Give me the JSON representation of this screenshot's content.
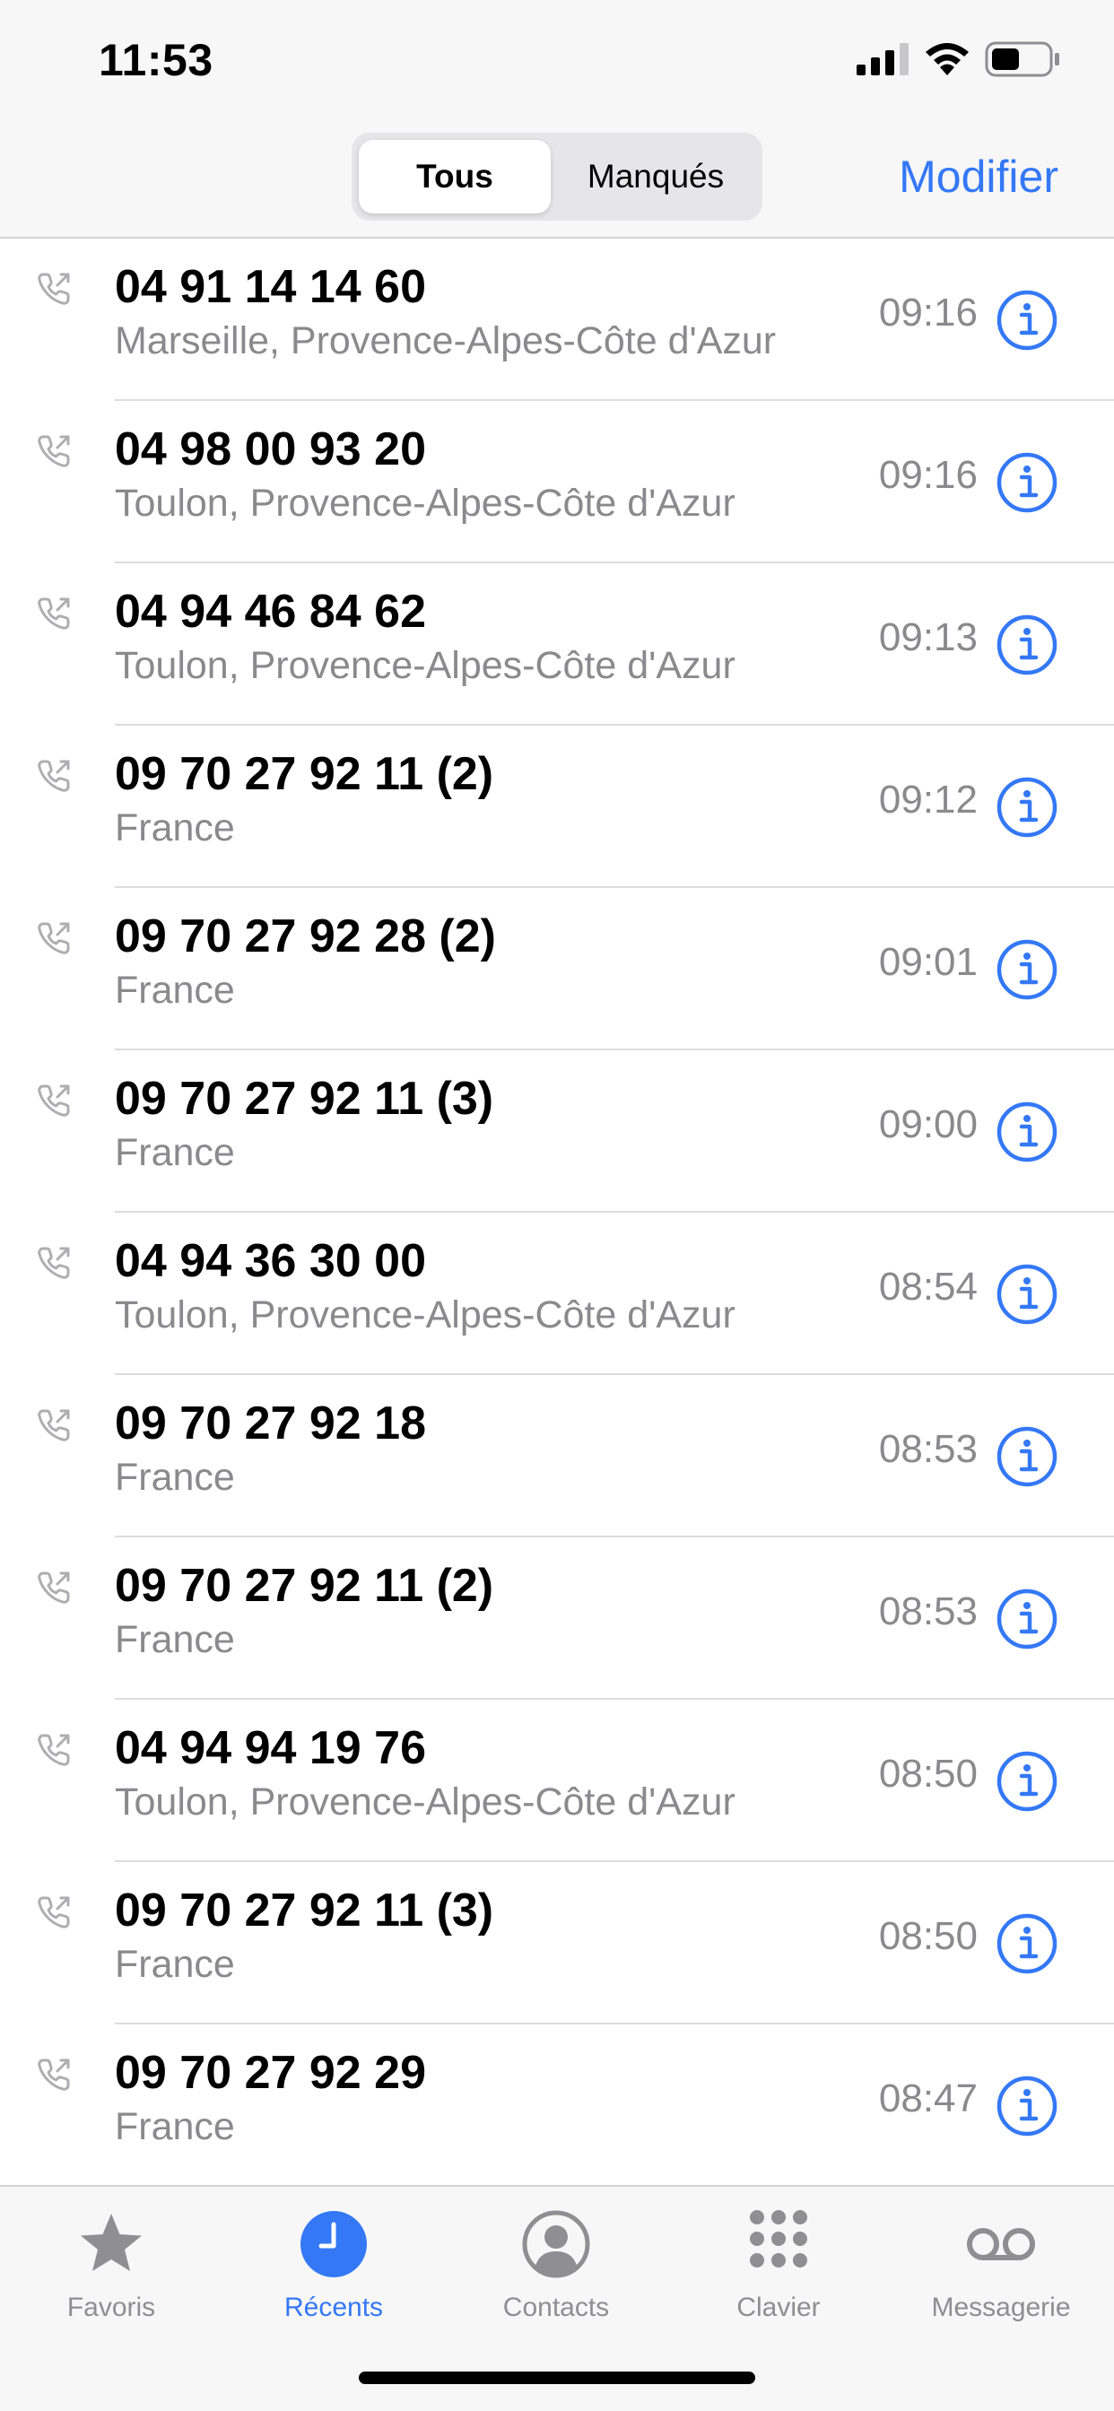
{
  "status_bar": {
    "time": "11:53",
    "icons": [
      "cellular-signal-icon",
      "wifi-icon",
      "battery-icon"
    ]
  },
  "nav": {
    "segments": [
      "Tous",
      "Manqués"
    ],
    "selected_segment": "Tous",
    "edit_label": "Modifier"
  },
  "colors": {
    "accent": "#3478f6",
    "secondary_text": "#8a8a8e",
    "separator": "#dcdcde"
  },
  "calls": [
    {
      "number": "04 91 14 14 60",
      "location": "Marseille, Provence-Alpes-Côte d'Azur",
      "time": "09:16"
    },
    {
      "number": "04 98 00 93 20",
      "location": "Toulon, Provence-Alpes-Côte d'Azur",
      "time": "09:16"
    },
    {
      "number": "04 94 46 84 62",
      "location": "Toulon, Provence-Alpes-Côte d'Azur",
      "time": "09:13"
    },
    {
      "number": "09 70 27 92 11 (2)",
      "location": "France",
      "time": "09:12"
    },
    {
      "number": "09 70 27 92 28 (2)",
      "location": "France",
      "time": "09:01"
    },
    {
      "number": "09 70 27 92 11 (3)",
      "location": "France",
      "time": "09:00"
    },
    {
      "number": "04 94 36 30 00",
      "location": "Toulon, Provence-Alpes-Côte d'Azur",
      "time": "08:54"
    },
    {
      "number": "09 70 27 92 18",
      "location": "France",
      "time": "08:53"
    },
    {
      "number": "09 70 27 92 11 (2)",
      "location": "France",
      "time": "08:53"
    },
    {
      "number": "04 94 94 19 76",
      "location": "Toulon, Provence-Alpes-Côte d'Azur",
      "time": "08:50"
    },
    {
      "number": "09 70 27 92 11 (3)",
      "location": "France",
      "time": "08:50"
    },
    {
      "number": "09 70 27 92 29",
      "location": "France",
      "time": "08:47"
    }
  ],
  "call_icons": {
    "call_type": "outgoing-call-icon",
    "info": "info-icon"
  },
  "tabs": [
    {
      "label": "Favoris",
      "icon": "star-icon",
      "active": false
    },
    {
      "label": "Récents",
      "icon": "clock-icon",
      "active": true
    },
    {
      "label": "Contacts",
      "icon": "person-circle-icon",
      "active": false
    },
    {
      "label": "Clavier",
      "icon": "keypad-icon",
      "active": false
    },
    {
      "label": "Messagerie",
      "icon": "voicemail-icon",
      "active": false
    }
  ]
}
